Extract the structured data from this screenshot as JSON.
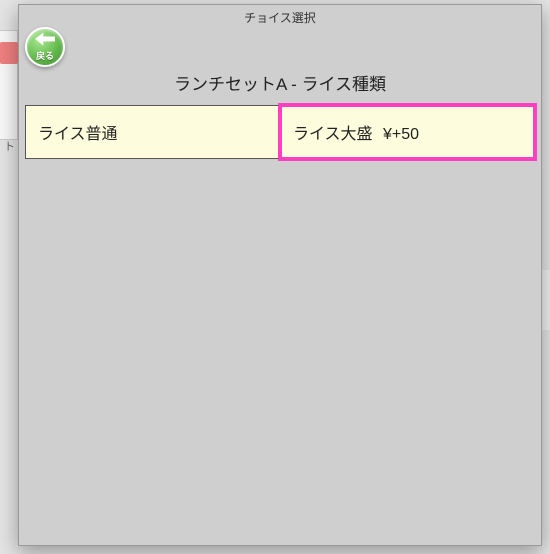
{
  "backdrop": {
    "tab_label": "ト"
  },
  "modal": {
    "title": "チョイス選択",
    "back_label": "戻る",
    "heading": "ランチセットA - ライス種類",
    "options": [
      {
        "label": "ライス普通",
        "price": ""
      },
      {
        "label": "ライス大盛",
        "price": "¥+50"
      }
    ]
  }
}
